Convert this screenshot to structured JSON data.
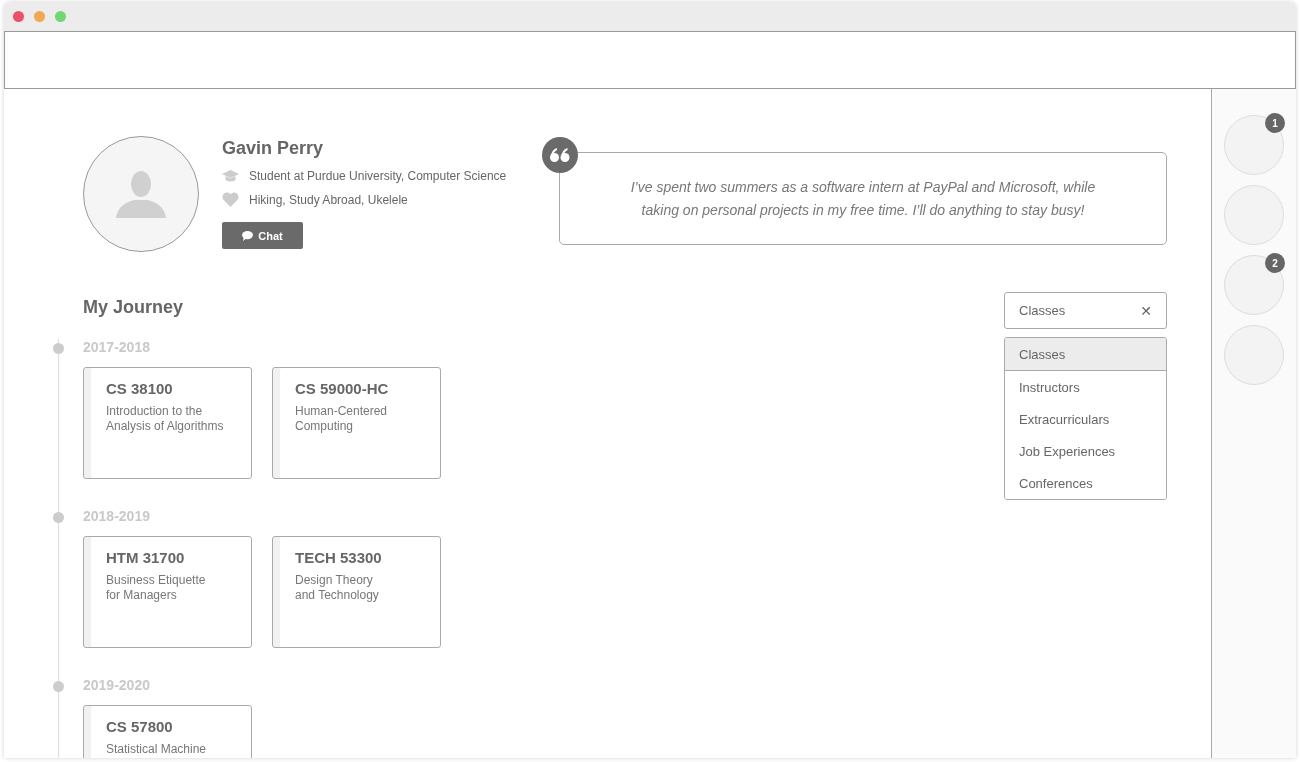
{
  "profile": {
    "name": "Gavin Perry",
    "education": "Student at Purdue University, Computer Science",
    "interests": "Hiking, Study Abroad, Ukelele",
    "chat_button": "Chat"
  },
  "quote": "I’ve spent two summers as a software intern at PayPal and Microsoft, while taking on personal projects in my free time. I’ll do anything to stay busy!",
  "journey": {
    "title": "My Journey",
    "years": [
      {
        "label": "2017-2018",
        "courses": [
          {
            "code": "CS 38100",
            "title": "Introduction to the\nAnalysis of Algorithms"
          },
          {
            "code": "CS 59000-HC",
            "title": "Human-Centered\nComputing"
          }
        ]
      },
      {
        "label": "2018-2019",
        "courses": [
          {
            "code": "HTM 31700",
            "title": "Business Etiquette\nfor Managers"
          },
          {
            "code": "TECH 53300",
            "title": "Design Theory\nand Technology"
          }
        ]
      },
      {
        "label": "2019-2020",
        "courses": [
          {
            "code": "CS 57800",
            "title": "Statistical Machine"
          }
        ]
      }
    ]
  },
  "filter": {
    "value": "Classes",
    "clear": "✕",
    "options": [
      {
        "label": "Classes",
        "selected": true
      },
      {
        "label": "Instructors",
        "selected": false
      },
      {
        "label": "Extracurriculars",
        "selected": false
      },
      {
        "label": "Job Experiences",
        "selected": false
      },
      {
        "label": "Conferences",
        "selected": false
      }
    ]
  },
  "sidebar": {
    "items": [
      {
        "kind": "badged",
        "badge": "1"
      },
      {
        "kind": "plain"
      },
      {
        "kind": "badged",
        "badge": "2"
      },
      {
        "kind": "plain"
      }
    ]
  }
}
